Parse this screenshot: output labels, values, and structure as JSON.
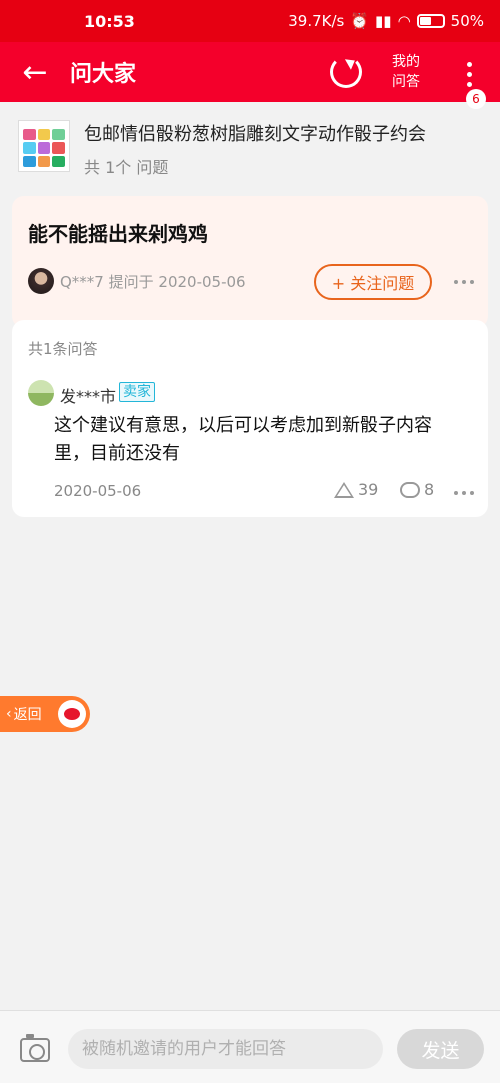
{
  "status_bar": {
    "time": "10:53",
    "network_speed": "39.7K/s",
    "battery": "50%"
  },
  "nav": {
    "title": "问大家",
    "my_answer": "我的问答",
    "badge_count": "6"
  },
  "product": {
    "title": "包邮情侣骰粉葱树脂雕刻文字动作骰子约会",
    "question_count": "共 1个 问题"
  },
  "question": {
    "title": "能不能摇出来剁鸡鸡",
    "asker": "Q***7",
    "asked_on": "提问于 2020-05-06",
    "follow_label": "+ 关注问题"
  },
  "answers": {
    "count_label": "共1条问答",
    "items": [
      {
        "user": "发***市",
        "tag": "卖家",
        "text": "这个建议有意思，以后可以考虑加到新骰子内容里，目前还没有",
        "date": "2020-05-06",
        "likes": "39",
        "comments": "8"
      }
    ]
  },
  "return_pill": {
    "label": "返回"
  },
  "bottom": {
    "placeholder": "被随机邀请的用户才能回答",
    "send_label": "发送"
  },
  "colors": {
    "primary": "#f4002b",
    "accent": "#e8641c",
    "seller": "#23b6d8"
  }
}
